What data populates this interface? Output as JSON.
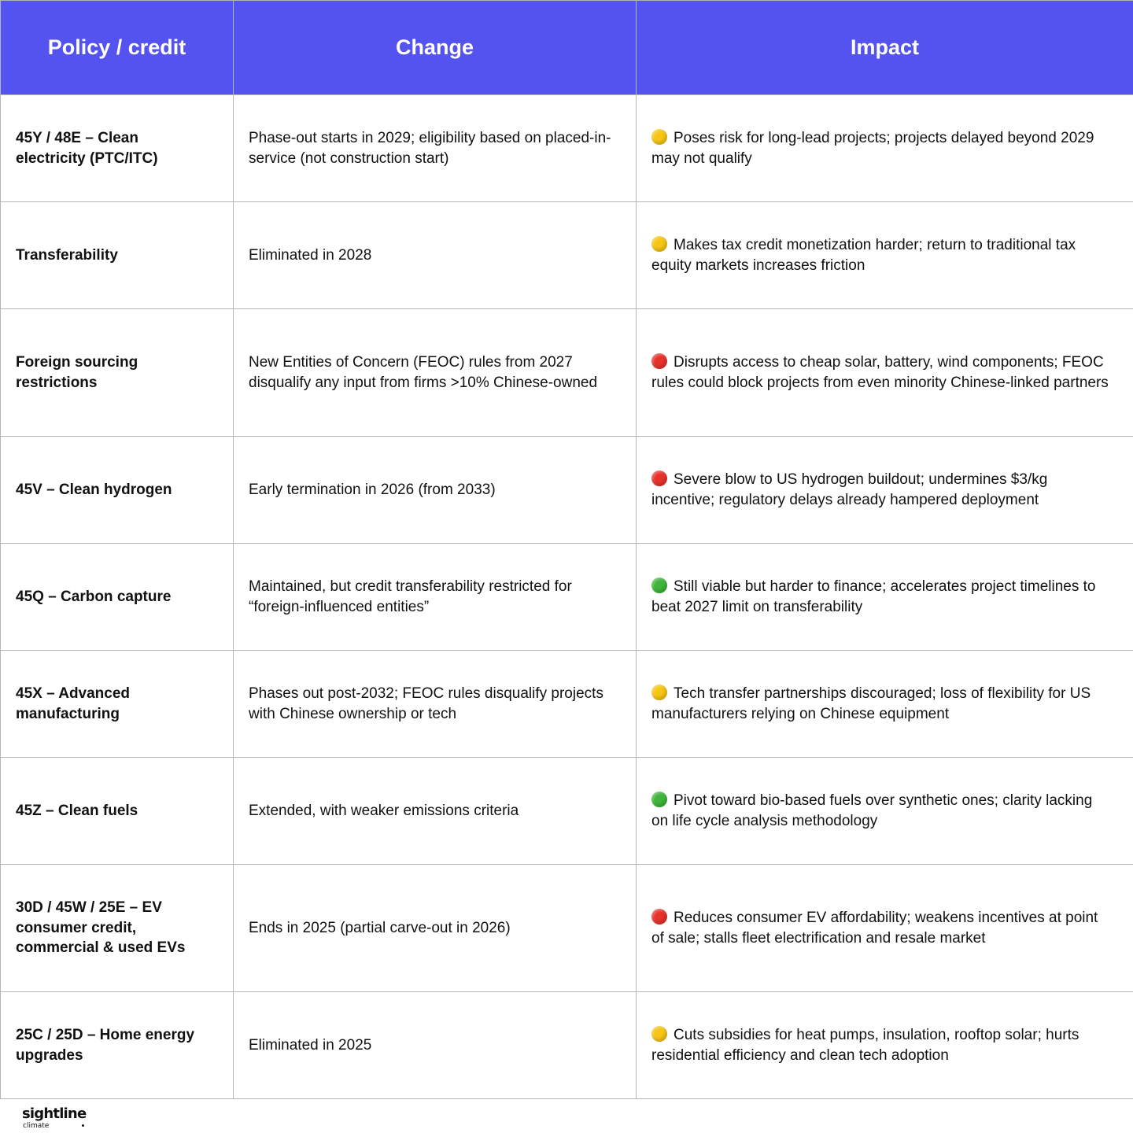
{
  "headers": {
    "policy": "Policy / credit",
    "change": "Change",
    "impact": "Impact"
  },
  "colors": {
    "header_bg": "#5553ef",
    "yellow": "#f7c514",
    "red": "#e8322b",
    "green": "#3fb43a"
  },
  "rows": [
    {
      "policy": "45Y / 48E – Clean electricity (PTC/ITC)",
      "change": "Phase-out starts in 2029; eligibility based on placed-in-service (not construction start)",
      "impact_level": "yellow",
      "impact": "Poses risk for long-lead projects; projects delayed beyond 2029 may not qualify"
    },
    {
      "policy": "Transferability",
      "change": "Eliminated in 2028",
      "impact_level": "yellow",
      "impact": "Makes tax credit monetization harder; return to traditional tax equity markets increases friction"
    },
    {
      "policy": "Foreign sourcing restrictions",
      "change": "New Entities of Concern (FEOC) rules from 2027 disqualify any input from firms >10% Chinese-owned",
      "impact_level": "red",
      "impact": "Disrupts access to cheap solar, battery, wind components; FEOC rules could block projects from even minority Chinese-linked partners"
    },
    {
      "policy": "45V – Clean hydrogen",
      "change": "Early termination in 2026 (from 2033)",
      "impact_level": "red",
      "impact": "Severe blow to US hydrogen buildout; undermines $3/kg incentive; regulatory delays already hampered deployment"
    },
    {
      "policy": "45Q – Carbon capture",
      "change": "Maintained, but credit transferability restricted for “foreign-influenced entities”",
      "impact_level": "green",
      "impact": "Still viable but harder to finance; accelerates project timelines to beat 2027 limit on transferability"
    },
    {
      "policy": "45X – Advanced manufacturing",
      "change": "Phases out post-2032; FEOC rules disqualify projects with Chinese ownership or tech",
      "impact_level": "yellow",
      "impact": "Tech transfer partnerships discouraged; loss of flexibility for US manufacturers relying on Chinese equipment"
    },
    {
      "policy": "45Z – Clean fuels",
      "change": "Extended, with weaker emissions criteria",
      "impact_level": "green",
      "impact": "Pivot toward bio-based fuels over synthetic ones; clarity lacking on life cycle analysis methodology"
    },
    {
      "policy": "30D / 45W / 25E – EV consumer credit, commercial & used EVs",
      "change": "Ends in 2025 (partial carve-out in 2026)",
      "impact_level": "red",
      "impact": "Reduces consumer EV affordability; weakens incentives at point of sale; stalls fleet electrification and resale market"
    },
    {
      "policy": "25C / 25D – Home energy upgrades",
      "change": "Eliminated in 2025",
      "impact_level": "yellow",
      "impact": "Cuts subsidies for heat pumps, insulation, rooftop solar; hurts residential efficiency and clean tech adoption"
    }
  ],
  "logo": {
    "name": "sightline",
    "tagline": "climate"
  }
}
